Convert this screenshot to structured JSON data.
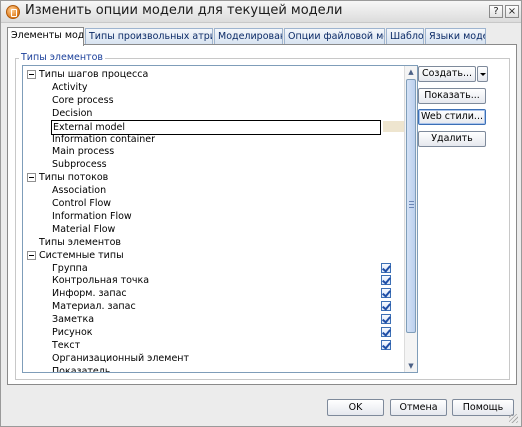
{
  "window": {
    "title": "Изменить опции модели для текущей модели",
    "help_label": "?",
    "close_label": "×"
  },
  "tabs": [
    {
      "label": "Элементы модели",
      "active": true
    },
    {
      "label": "Типы произвольных атрибутов",
      "active": false
    },
    {
      "label": "Моделирование",
      "active": false
    },
    {
      "label": "Опции файловой модели",
      "active": false
    },
    {
      "label": "Шаблон",
      "active": false
    },
    {
      "label": "Языки модели",
      "active": false
    }
  ],
  "group": {
    "legend": "Типы элементов"
  },
  "tree": {
    "rows": [
      {
        "label": "Типы шагов процесса",
        "expander": true,
        "checked": false
      },
      {
        "label": "Activity",
        "expander": false,
        "checked": false
      },
      {
        "label": "Core process",
        "expander": false,
        "checked": false
      },
      {
        "label": "Decision",
        "expander": false,
        "checked": false
      },
      {
        "label": "External model",
        "expander": false,
        "checked": false,
        "selected": true
      },
      {
        "label": "Information container",
        "expander": false,
        "checked": false
      },
      {
        "label": "Main process",
        "expander": false,
        "checked": false
      },
      {
        "label": "Subprocess",
        "expander": false,
        "checked": false
      },
      {
        "label": "Типы потоков",
        "expander": true,
        "checked": false
      },
      {
        "label": "Association",
        "expander": false,
        "checked": false
      },
      {
        "label": "Control Flow",
        "expander": false,
        "checked": false
      },
      {
        "label": "Information Flow",
        "expander": false,
        "checked": false
      },
      {
        "label": "Material Flow",
        "expander": false,
        "checked": false
      },
      {
        "label": "Типы элементов",
        "expander": false,
        "checked": false
      },
      {
        "label": "Системные типы",
        "expander": true,
        "checked": false
      },
      {
        "label": "Группа",
        "expander": false,
        "checked": true
      },
      {
        "label": "Контрольная точка",
        "expander": false,
        "checked": true
      },
      {
        "label": "Информ. запас",
        "expander": false,
        "checked": true
      },
      {
        "label": "Материал. запас",
        "expander": false,
        "checked": true
      },
      {
        "label": "Заметка",
        "expander": false,
        "checked": true
      },
      {
        "label": "Рисунок",
        "expander": false,
        "checked": true
      },
      {
        "label": "Текст",
        "expander": false,
        "checked": true
      },
      {
        "label": "Организационный элемент",
        "expander": false,
        "checked": false
      },
      {
        "label": "Показатель",
        "expander": false,
        "checked": false
      }
    ]
  },
  "side_buttons": {
    "create": "Создать...",
    "show": "Показать...",
    "web_styles": "Web стили...",
    "delete": "Удалить"
  },
  "footer": {
    "ok": "OK",
    "cancel": "Отмена",
    "help": "Помощь"
  }
}
